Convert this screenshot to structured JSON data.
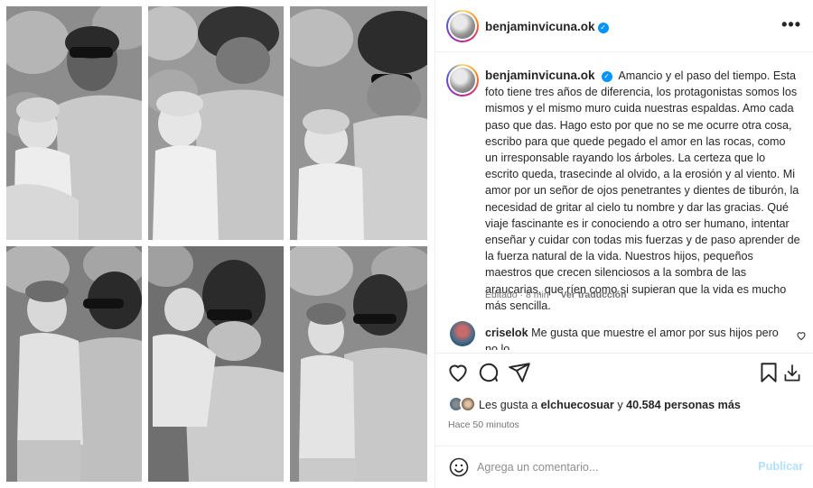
{
  "post": {
    "username": "benjaminvicuna.ok",
    "more_label": "•••"
  },
  "caption": {
    "username": "benjaminvicuna.ok",
    "text": "Amancio y el paso del tiempo. Esta foto tiene tres años de diferencia, los protagonistas somos los mismos y el mismo muro cuida nuestras espaldas. Amo cada paso que das. Hago esto por que no se me ocurre otra cosa, escribo para que quede pegado el amor en las rocas, como un irresponsable rayando los árboles. La certeza que lo escrito queda, trasecinde al olvido, a la erosión y al viento. Mi amor por un señor de ojos penetrantes y dientes de tiburón, la necesidad de gritar al cielo tu nombre y dar las gracias. Qué viaje fascinante es ir conociendo a otro ser humano, intentar enseñar y cuidar con todas mis fuerzas y de paso aprender de la fuerza natural de la vida. Nuestros hijos, pequeños maestros que crecen silenciosos a la sombra de las araucarias, que ríen como si supieran que la vida es mucho más sencilla.",
    "edited": "Editado · 8 min",
    "translate": "Ver traducción"
  },
  "comment": {
    "username": "criselok",
    "text": "Me gusta que muestre el amor por sus hijos pero no lo"
  },
  "likes": {
    "prefix": "Les gusta a",
    "user": "elchuecosuar",
    "connector": "y",
    "count": "40.584 personas más"
  },
  "timestamp": "Hace 50 minutos",
  "add_comment": {
    "placeholder": "Agrega un comentario...",
    "publish": "Publicar"
  },
  "icons": [
    "heart-icon",
    "comment-icon",
    "share-icon",
    "bookmark-icon",
    "download-icon",
    "emoji-icon",
    "more-icon",
    "verified-icon"
  ],
  "colors": {
    "verified": "#0095f6",
    "muted": "#737373",
    "publish_disabled": "#b2dffc"
  }
}
